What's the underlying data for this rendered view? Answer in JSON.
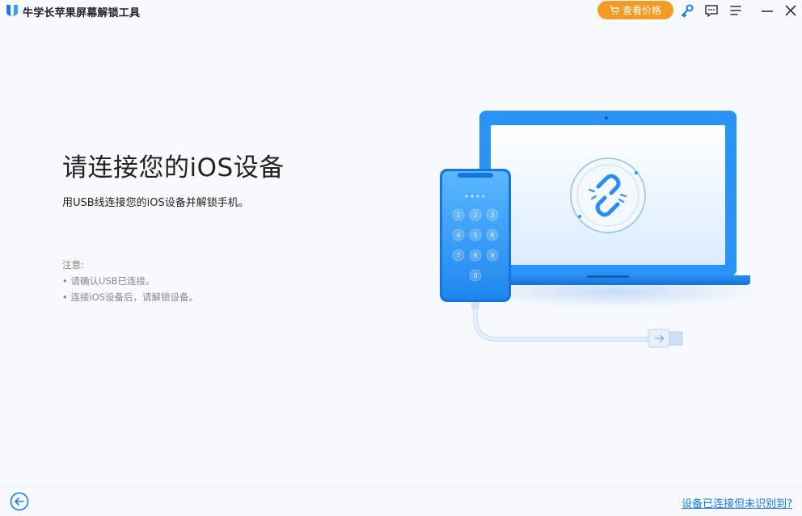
{
  "app": {
    "title": "牛学长苹果屏幕解锁工具",
    "accent_color": "#1a7ae8",
    "price_button_color": "#f59a23"
  },
  "titlebar": {
    "price_label": "查看价格",
    "icons": [
      "cart-icon",
      "key-icon",
      "feedback-icon",
      "menu-icon",
      "minimize-icon",
      "close-icon"
    ]
  },
  "main": {
    "heading": "请连接您的iOS设备",
    "subheading": "用USB线连接您的iOS设备并解锁手机。",
    "notes_title": "注意:",
    "notes": [
      "• 请确认USB已连接。",
      "• 连接iOS设备后，请解锁设备。"
    ]
  },
  "phone": {
    "keypad": [
      "1",
      "2",
      "3",
      "4",
      "5",
      "6",
      "7",
      "8",
      "9",
      "0"
    ]
  },
  "footer": {
    "help_link": "设备已连接但未识别到?"
  }
}
